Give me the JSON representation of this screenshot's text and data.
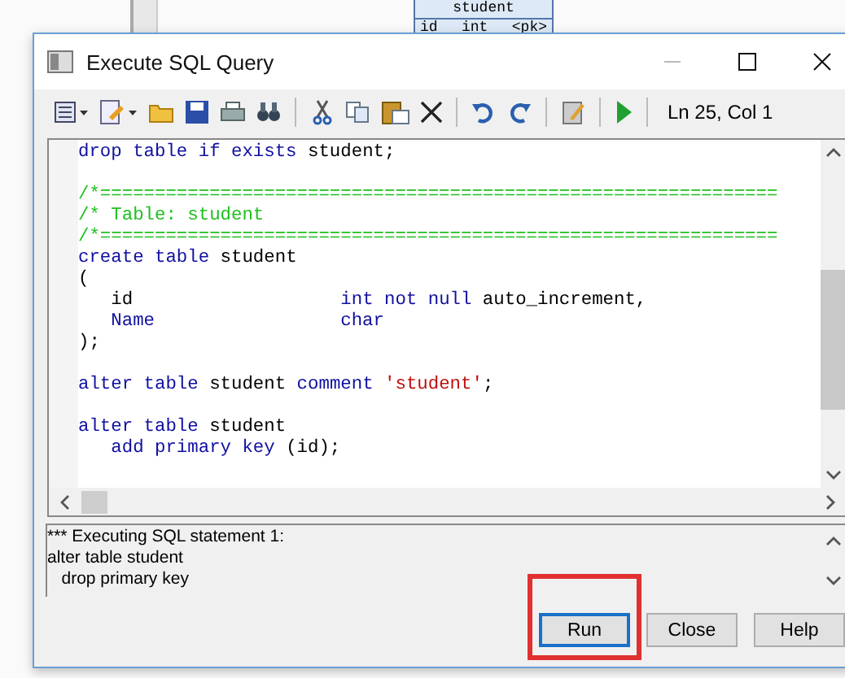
{
  "background_diagram": {
    "entity_title": "student",
    "entity_row": [
      "id",
      "int",
      "<pk>"
    ]
  },
  "window": {
    "title": "Execute SQL Query"
  },
  "toolbar": {
    "position": "Ln 25, Col 1"
  },
  "editor": {
    "lines": [
      {
        "kind": "code",
        "segments": [
          {
            "kind": "keyword",
            "text": "drop table if exists"
          },
          {
            "kind": "plain",
            "text": " student;"
          }
        ]
      },
      {
        "kind": "blank"
      },
      {
        "kind": "code",
        "segments": [
          {
            "kind": "comment",
            "text": "/*=============================================================="
          }
        ]
      },
      {
        "kind": "code",
        "segments": [
          {
            "kind": "comment",
            "text": "/* Table: student"
          }
        ]
      },
      {
        "kind": "code",
        "segments": [
          {
            "kind": "comment",
            "text": "/*=============================================================="
          }
        ]
      },
      {
        "kind": "code",
        "segments": [
          {
            "kind": "keyword",
            "text": "create table"
          },
          {
            "kind": "plain",
            "text": " student"
          }
        ]
      },
      {
        "kind": "code",
        "segments": [
          {
            "kind": "plain",
            "text": "("
          }
        ]
      },
      {
        "kind": "code",
        "segments": [
          {
            "kind": "plain",
            "text": "   id                   "
          },
          {
            "kind": "keyword",
            "text": "int not null"
          },
          {
            "kind": "plain",
            "text": " auto_increment,"
          }
        ]
      },
      {
        "kind": "code",
        "segments": [
          {
            "kind": "keyword",
            "text": "   Name                 char"
          }
        ]
      },
      {
        "kind": "code",
        "segments": [
          {
            "kind": "plain",
            "text": ");"
          }
        ]
      },
      {
        "kind": "blank"
      },
      {
        "kind": "code",
        "segments": [
          {
            "kind": "keyword",
            "text": "alter table"
          },
          {
            "kind": "plain",
            "text": " student "
          },
          {
            "kind": "keyword",
            "text": "comment"
          },
          {
            "kind": "string",
            "text": " 'student'"
          },
          {
            "kind": "plain",
            "text": ";"
          }
        ]
      },
      {
        "kind": "blank"
      },
      {
        "kind": "code",
        "segments": [
          {
            "kind": "keyword",
            "text": "alter table"
          },
          {
            "kind": "plain",
            "text": " student"
          }
        ]
      },
      {
        "kind": "code",
        "segments": [
          {
            "kind": "keyword",
            "text": "   add primary key"
          },
          {
            "kind": "plain",
            "text": " (id);"
          }
        ]
      }
    ]
  },
  "output": {
    "lines": [
      "*** Executing SQL statement 1:",
      "alter table student",
      "   drop primary key"
    ]
  },
  "buttons": [
    {
      "label": "Run",
      "default": true,
      "highlighted": true
    },
    {
      "label": "Close",
      "default": false,
      "highlighted": false
    },
    {
      "label": "Help",
      "default": false,
      "highlighted": false
    }
  ]
}
